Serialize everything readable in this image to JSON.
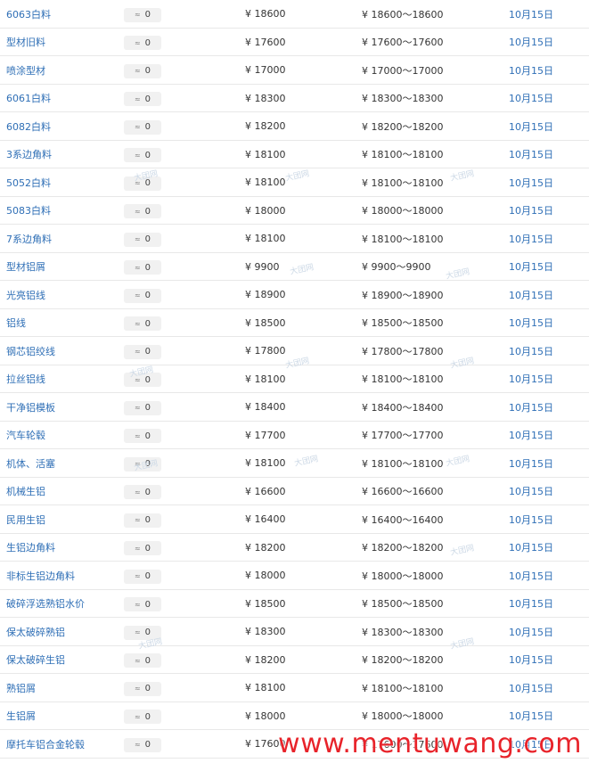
{
  "table": {
    "rows": [
      {
        "name": "6063白料",
        "change": "0",
        "price": "¥ 18600",
        "range": "¥ 18600～18600",
        "date": "10月15日"
      },
      {
        "name": "型材旧料",
        "change": "0",
        "price": "¥ 17600",
        "range": "¥ 17600～17600",
        "date": "10月15日"
      },
      {
        "name": "喷涂型材",
        "change": "0",
        "price": "¥ 17000",
        "range": "¥ 17000～17000",
        "date": "10月15日"
      },
      {
        "name": "6061白料",
        "change": "0",
        "price": "¥ 18300",
        "range": "¥ 18300～18300",
        "date": "10月15日"
      },
      {
        "name": "6082白料",
        "change": "0",
        "price": "¥ 18200",
        "range": "¥ 18200～18200",
        "date": "10月15日"
      },
      {
        "name": "3系边角料",
        "change": "0",
        "price": "¥ 18100",
        "range": "¥ 18100～18100",
        "date": "10月15日"
      },
      {
        "name": "5052白料",
        "change": "0",
        "price": "¥ 18100",
        "range": "¥ 18100～18100",
        "date": "10月15日"
      },
      {
        "name": "5083白料",
        "change": "0",
        "price": "¥ 18000",
        "range": "¥ 18000～18000",
        "date": "10月15日"
      },
      {
        "name": "7系边角料",
        "change": "0",
        "price": "¥ 18100",
        "range": "¥ 18100～18100",
        "date": "10月15日"
      },
      {
        "name": "型材铝屑",
        "change": "0",
        "price": "¥ 9900",
        "range": "¥ 9900～9900",
        "date": "10月15日"
      },
      {
        "name": "光亮铝线",
        "change": "0",
        "price": "¥ 18900",
        "range": "¥ 18900～18900",
        "date": "10月15日"
      },
      {
        "name": "铝线",
        "change": "0",
        "price": "¥ 18500",
        "range": "¥ 18500～18500",
        "date": "10月15日"
      },
      {
        "name": "钢芯铝绞线",
        "change": "0",
        "price": "¥ 17800",
        "range": "¥ 17800～17800",
        "date": "10月15日"
      },
      {
        "name": "拉丝铝线",
        "change": "0",
        "price": "¥ 18100",
        "range": "¥ 18100～18100",
        "date": "10月15日"
      },
      {
        "name": "干净铝模板",
        "change": "0",
        "price": "¥ 18400",
        "range": "¥ 18400～18400",
        "date": "10月15日"
      },
      {
        "name": "汽车轮毂",
        "change": "0",
        "price": "¥ 17700",
        "range": "¥ 17700～17700",
        "date": "10月15日"
      },
      {
        "name": "机体、活塞",
        "change": "0",
        "price": "¥ 18100",
        "range": "¥ 18100～18100",
        "date": "10月15日"
      },
      {
        "name": "机械生铝",
        "change": "0",
        "price": "¥ 16600",
        "range": "¥ 16600～16600",
        "date": "10月15日"
      },
      {
        "name": "民用生铝",
        "change": "0",
        "price": "¥ 16400",
        "range": "¥ 16400～16400",
        "date": "10月15日"
      },
      {
        "name": "生铝边角料",
        "change": "0",
        "price": "¥ 18200",
        "range": "¥ 18200～18200",
        "date": "10月15日"
      },
      {
        "name": "非标生铝边角料",
        "change": "0",
        "price": "¥ 18000",
        "range": "¥ 18000～18000",
        "date": "10月15日"
      },
      {
        "name": "破碎浮选熟铝水价",
        "change": "0",
        "price": "¥ 18500",
        "range": "¥ 18500～18500",
        "date": "10月15日"
      },
      {
        "name": "保太破碎熟铝",
        "change": "0",
        "price": "¥ 18300",
        "range": "¥ 18300～18300",
        "date": "10月15日"
      },
      {
        "name": "保太破碎生铝",
        "change": "0",
        "price": "¥ 18200",
        "range": "¥ 18200～18200",
        "date": "10月15日"
      },
      {
        "name": "熟铝屑",
        "change": "0",
        "price": "¥ 18100",
        "range": "¥ 18100～18100",
        "date": "10月15日"
      },
      {
        "name": "生铝屑",
        "change": "0",
        "price": "¥ 18000",
        "range": "¥ 18000～18000",
        "date": "10月15日"
      },
      {
        "name": "摩托车铝合金轮毂",
        "change": "0",
        "price": "¥ 17600",
        "range": "¥ 17600～17600",
        "date": "10月15日"
      }
    ]
  },
  "watermark": {
    "text": "www.mentuwang.com",
    "faint_text": "大团网"
  },
  "colors": {
    "link": "#2f6fb6",
    "watermark": "#e8232a",
    "badge_bg": "#f1f1f1",
    "row_border": "#e8e8e8"
  },
  "icons": {
    "change": "approx-arrow-icon"
  }
}
